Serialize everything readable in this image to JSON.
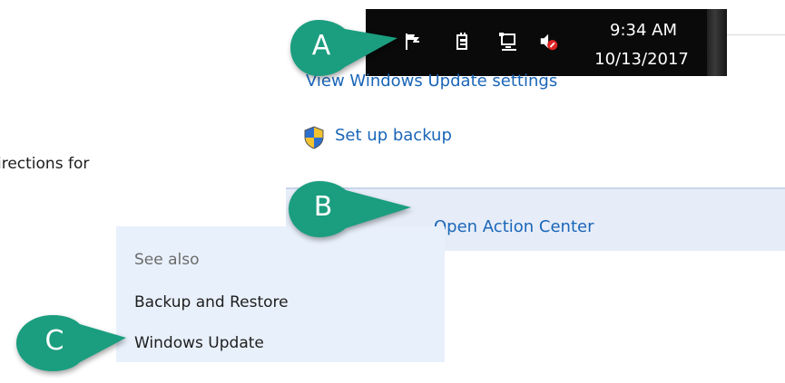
{
  "page": {
    "cropped_text": "irections for"
  },
  "taskbar": {
    "time": "9:34 AM",
    "date": "10/13/2017",
    "icons": [
      "flag-icon",
      "power-plug-icon",
      "network-icon",
      "volume-muted-icon"
    ]
  },
  "links": {
    "update_settings": "View Windows Update settings",
    "backup": "Set up backup",
    "action_center": "Open Action Center"
  },
  "see_also": {
    "title": "See also",
    "items": [
      "Backup and Restore",
      "Windows Update"
    ]
  },
  "callouts": {
    "a": "A",
    "b": "B",
    "c": "C",
    "color": "#1a9e7f"
  }
}
